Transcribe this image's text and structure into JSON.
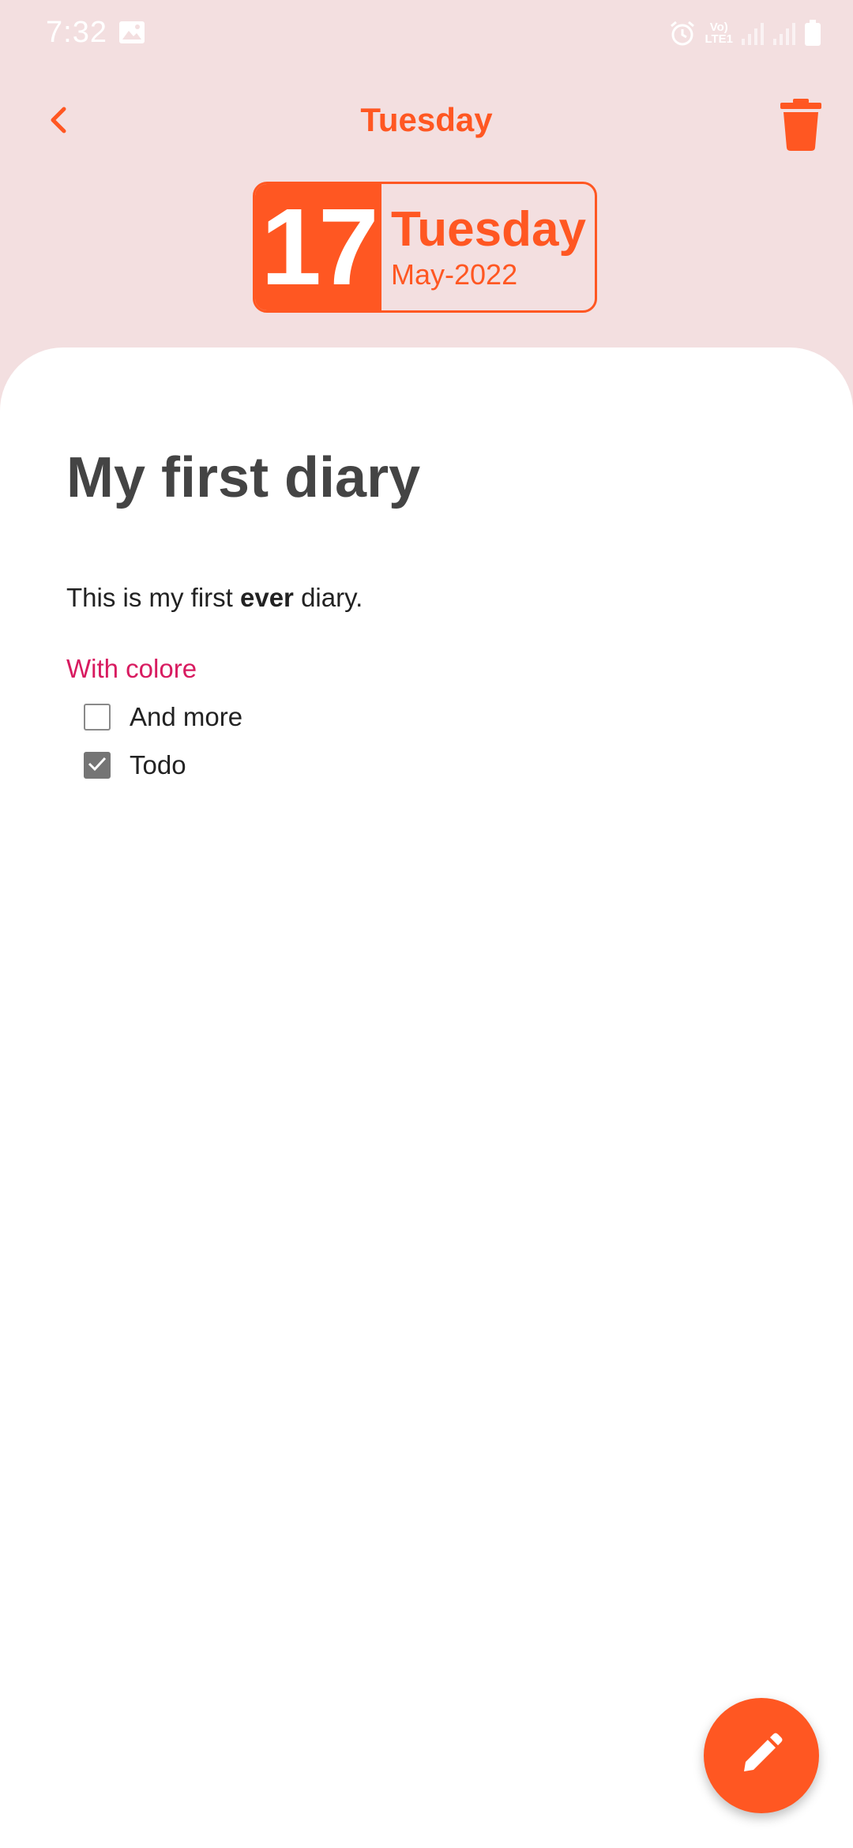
{
  "status_bar": {
    "time": "7:32",
    "network_label_top": "Vo)",
    "network_label_bottom": "LTE1",
    "icons": [
      "image-icon",
      "alarm-icon",
      "signal-icon",
      "signal-icon",
      "battery-icon"
    ]
  },
  "app_bar": {
    "title": "Tuesday",
    "back_icon": "chevron-left-icon",
    "delete_icon": "trash-icon"
  },
  "date_badge": {
    "day_number": "17",
    "weekday": "Tuesday",
    "month_year": "May-2022"
  },
  "diary": {
    "title": "My first diary",
    "line_prefix": "This is my first ",
    "line_bold": "ever",
    "line_suffix": " diary.",
    "color_text": "With colore",
    "todos": [
      {
        "label": "And more",
        "checked": false
      },
      {
        "label": "Todo",
        "checked": true
      }
    ]
  },
  "fab": {
    "icon": "pencil-icon"
  },
  "colors": {
    "accent": "#ff5722",
    "header_bg": "#f3dfe0",
    "color_text": "#d81b60"
  }
}
